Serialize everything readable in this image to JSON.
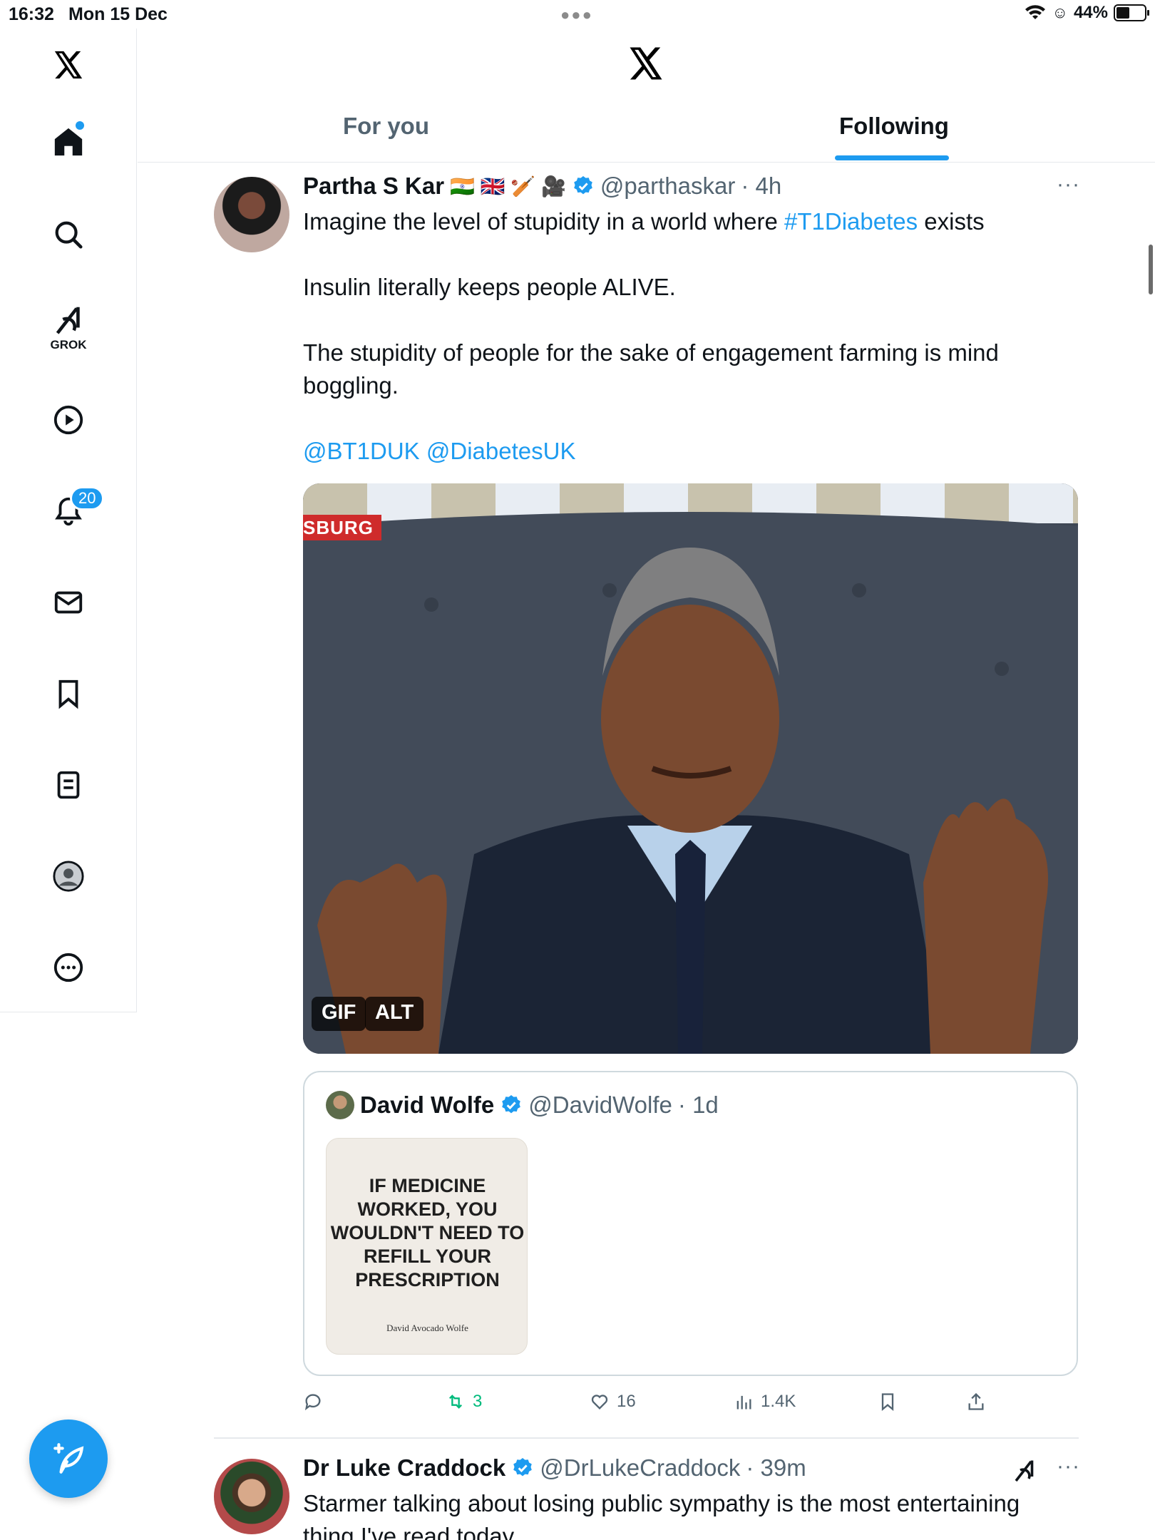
{
  "status_bar": {
    "time": "16:32",
    "date": "Mon 15 Dec",
    "battery": "44%"
  },
  "sidebar": {
    "grok_label": "GROK",
    "notifications_badge": "20"
  },
  "header": {
    "tabs": [
      {
        "label": "For you",
        "active": false
      },
      {
        "label": "Following",
        "active": true
      }
    ]
  },
  "tweet": {
    "author": "Partha S Kar",
    "emojis": "🇮🇳 🇬🇧 🏏 🎥",
    "handle": "@parthaskar",
    "time": "· 4h",
    "line1_prefix": "Imagine the level of stupidity in a world where ",
    "line1_hashtag": "#T1Diabetes",
    "line1_suffix": " exists",
    "para2": "Insulin literally keeps people ALIVE.",
    "para3": "The stupidity of people for the sake of engagement farming is mind boggling.",
    "mention1": "@BT1DUK",
    "mention2": "@DiabetesUK",
    "media_tags": [
      "GIF",
      "ALT"
    ],
    "media_overlay_text": "SBURG",
    "quote": {
      "author": "David Wolfe",
      "handle": "@DavidWolfe",
      "time": "· 1d",
      "image_headline": "IF MEDICINE WORKED, YOU WOULDN'T NEED TO REFILL YOUR PRESCRIPTION",
      "image_signature": "David Avocado Wolfe"
    },
    "stats": {
      "retweets": "3",
      "likes": "16",
      "views": "1.4K"
    }
  },
  "tweet2": {
    "author": "Dr Luke Craddock",
    "handle": "@DrLukeCraddock",
    "time": "· 39m",
    "text": "Starmer talking about losing public sympathy is the most entertaining thing I've read today"
  },
  "colors": {
    "accent": "#1d9bf0",
    "retweet": "#00ba7c",
    "muted": "#536471"
  }
}
